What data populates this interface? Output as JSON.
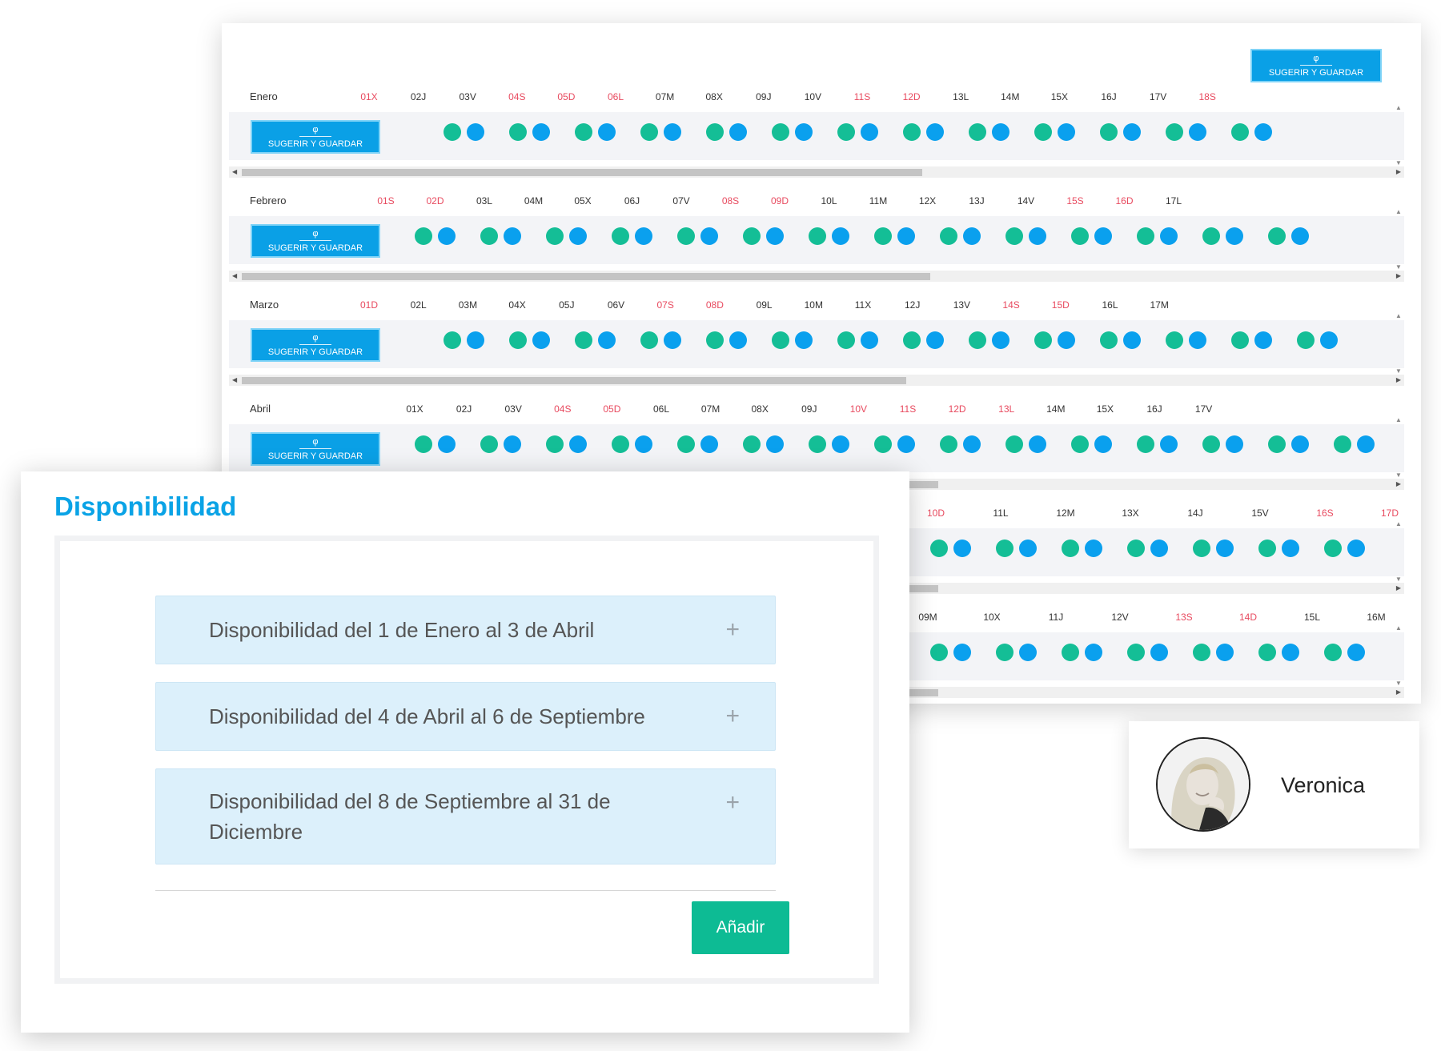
{
  "calendar": {
    "top_button": {
      "icon": "φ",
      "label": "SUGERIR Y GUARDAR"
    },
    "row_button": {
      "icon": "φ",
      "label": "SUGERIR Y GUARDAR"
    },
    "colors": {
      "green": "#14be96",
      "blue": "#0aa0ee",
      "weekend": "#e84a5f",
      "button": "#0aa0e6"
    },
    "months": [
      {
        "name": "Enero",
        "days": [
          "01X",
          "02J",
          "03V",
          "04S",
          "05D",
          "06L",
          "07M",
          "08X",
          "09J",
          "10V",
          "11S",
          "12D",
          "13L",
          "14M",
          "15X",
          "16J",
          "17V",
          "18S"
        ],
        "weekend": [
          true,
          false,
          false,
          true,
          true,
          true,
          false,
          false,
          false,
          false,
          true,
          true,
          false,
          false,
          false,
          false,
          false,
          true
        ],
        "dot_pairs": 13
      },
      {
        "name": "Febrero",
        "days": [
          "01S",
          "02D",
          "03L",
          "04M",
          "05X",
          "06J",
          "07V",
          "08S",
          "09D",
          "10L",
          "11M",
          "12X",
          "13J",
          "14V",
          "15S",
          "16D",
          "17L"
        ],
        "weekend": [
          true,
          true,
          false,
          false,
          false,
          false,
          false,
          true,
          true,
          false,
          false,
          false,
          false,
          false,
          true,
          true,
          false
        ],
        "dot_pairs": 14
      },
      {
        "name": "Marzo",
        "days": [
          "01D",
          "02L",
          "03M",
          "04X",
          "05J",
          "06V",
          "07S",
          "08D",
          "09L",
          "10M",
          "11X",
          "12J",
          "13V",
          "14S",
          "15D",
          "16L",
          "17M"
        ],
        "weekend": [
          true,
          false,
          false,
          false,
          false,
          false,
          true,
          true,
          false,
          false,
          false,
          false,
          false,
          true,
          true,
          false,
          false
        ],
        "dot_pairs": 14
      },
      {
        "name": "Abril",
        "days": [
          "01X",
          "02J",
          "03V",
          "04S",
          "05D",
          "06L",
          "07M",
          "08X",
          "09J",
          "10V",
          "11S",
          "12D",
          "13L",
          "14M",
          "15X",
          "16J",
          "17V"
        ],
        "weekend": [
          false,
          false,
          false,
          true,
          true,
          false,
          false,
          false,
          false,
          true,
          true,
          true,
          true,
          false,
          false,
          false,
          false
        ],
        "dot_pairs": 15
      },
      {
        "name": "",
        "days": [
          "10D",
          "11L",
          "12M",
          "13X",
          "14J",
          "15V",
          "16S",
          "17D"
        ],
        "weekend": [
          true,
          false,
          false,
          false,
          false,
          false,
          true,
          true
        ],
        "dot_pairs": 7
      },
      {
        "name": "",
        "days": [
          "09M",
          "10X",
          "11J",
          "12V",
          "13S",
          "14D",
          "15L",
          "16M"
        ],
        "weekend": [
          false,
          false,
          false,
          false,
          true,
          true,
          false,
          false
        ],
        "dot_pairs": 8
      }
    ]
  },
  "disponibilidad": {
    "title": "Disponibilidad",
    "items": [
      {
        "label": "Disponibilidad del 1 de Enero al 3 de Abril",
        "icon": "plus-icon"
      },
      {
        "label": "Disponibilidad del 4 de Abril al 6 de Septiembre",
        "icon": "plus-icon"
      },
      {
        "label": "Disponibilidad del 8 de Septiembre al 31 de Diciembre",
        "icon": "plus-icon"
      }
    ],
    "add_button": "Añadir",
    "plus_glyph": "+"
  },
  "profile": {
    "name": "Veronica",
    "avatar_icon": "user-avatar"
  }
}
